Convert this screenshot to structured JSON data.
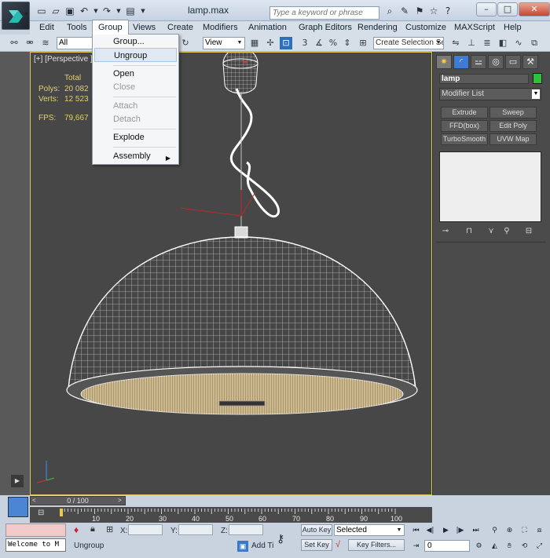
{
  "window": {
    "title": "lamp.max",
    "search_placeholder": "Type a keyword or phrase",
    "controls": [
      "–",
      "□",
      "✕"
    ]
  },
  "quick_access": [
    "new-icon",
    "open-icon",
    "save-icon",
    "undo-icon",
    "redo-icon",
    "project-folder-icon"
  ],
  "menubar": {
    "items": [
      "Edit",
      "Tools",
      "Group",
      "Views",
      "Create",
      "Modifiers",
      "Animation",
      "Graph Editors",
      "Rendering",
      "Customize",
      "MAXScript",
      "Help"
    ],
    "active": "Group"
  },
  "group_menu": {
    "items": [
      {
        "label": "Group...",
        "enabled": true
      },
      {
        "label": "Ungroup",
        "enabled": true,
        "highlighted": true
      },
      {
        "label": "Open",
        "enabled": true
      },
      {
        "label": "Close",
        "enabled": false
      },
      {
        "label": "Attach",
        "enabled": false
      },
      {
        "label": "Detach",
        "enabled": false
      },
      {
        "label": "Explode",
        "enabled": true
      },
      {
        "label": "Assembly",
        "enabled": true,
        "has_submenu": true
      }
    ]
  },
  "toolbar": {
    "filter_value": "All",
    "view_value": "View",
    "selection_set_placeholder": "Create Selection Se"
  },
  "viewport": {
    "label": "[+] [Perspective ] [",
    "stats": {
      "header": "Total",
      "polys_label": "Polys:",
      "polys_value": "20 082",
      "verts_label": "Verts:",
      "verts_value": "12 523",
      "fps_label": "FPS:",
      "fps_value": "79,667"
    }
  },
  "command_panel": {
    "object_name": "lamp",
    "object_color": "#2dc23a",
    "modifier_list": "Modifier List",
    "modifier_buttons": [
      "Extrude",
      "Sweep",
      "FFD(box)",
      "Edit Poly",
      "TurboSmooth",
      "UVW Map"
    ]
  },
  "timeline": {
    "frame_label": "0 / 100",
    "ticks": [
      "10",
      "20",
      "30",
      "40",
      "50",
      "60",
      "70",
      "80",
      "90",
      "100"
    ]
  },
  "status": {
    "listener_text": "Welcome to M",
    "prompt": "Ungroup",
    "x_label": "X:",
    "y_label": "Y:",
    "z_label": "Z:",
    "add_time_tag": "Add Ti",
    "auto_key": "Auto Key",
    "set_key": "Set Key",
    "selected_value": "Selected",
    "key_filters": "Key Filters...",
    "current_frame": "0"
  }
}
